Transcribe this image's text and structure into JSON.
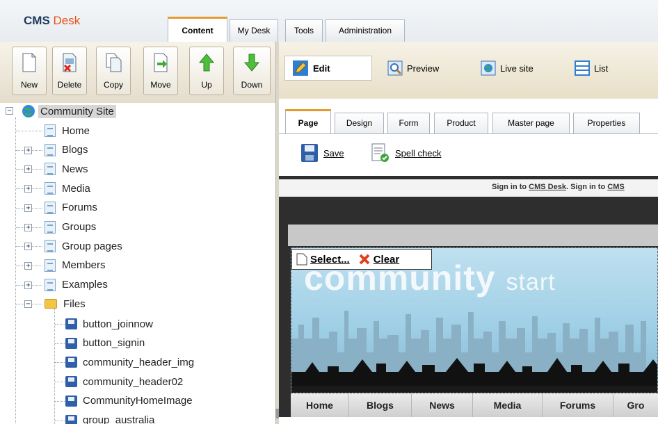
{
  "app": {
    "logo_part1": "CMS",
    "logo_part2": "Desk"
  },
  "main_tabs": [
    {
      "label": "Content",
      "active": true
    },
    {
      "label": "My Desk",
      "active": false
    },
    {
      "label": "Tools",
      "active": false
    },
    {
      "label": "Administration",
      "active": false
    }
  ],
  "toolbar": {
    "new": "New",
    "delete": "Delete",
    "copy": "Copy",
    "move": "Move",
    "up": "Up",
    "down": "Down"
  },
  "view_modes": {
    "edit": "Edit",
    "preview": "Preview",
    "live_site": "Live site",
    "list": "List"
  },
  "tree": {
    "root": "Community Site",
    "items": [
      "Home",
      "Blogs",
      "News",
      "Media",
      "Forums",
      "Groups",
      "Group pages",
      "Members",
      "Examples",
      "Files"
    ],
    "files": [
      "button_joinnow",
      "button_signin",
      "community_header_img",
      "community_header02",
      "CommunityHomeImage",
      "group_australia"
    ]
  },
  "page_tabs": [
    "Page",
    "Design",
    "Form",
    "Product",
    "Master page",
    "Properties"
  ],
  "actions": {
    "save": "Save",
    "spell_check": "Spell check"
  },
  "preview": {
    "sign_prefix": "Sign in to ",
    "sign_link1": "CMS Desk",
    "sign_middle": ". Sign in to ",
    "sign_link2": "CMS",
    "select": "Select...",
    "clear": "Clear",
    "banner_text": "community",
    "banner_text_small": "start",
    "nav": [
      "Home",
      "Blogs",
      "News",
      "Media",
      "Forums",
      "Gro"
    ]
  },
  "colors": {
    "accent": "#e8501c",
    "tab_highlight": "#e79b2f",
    "tree_selection": "#d6d6d6"
  }
}
